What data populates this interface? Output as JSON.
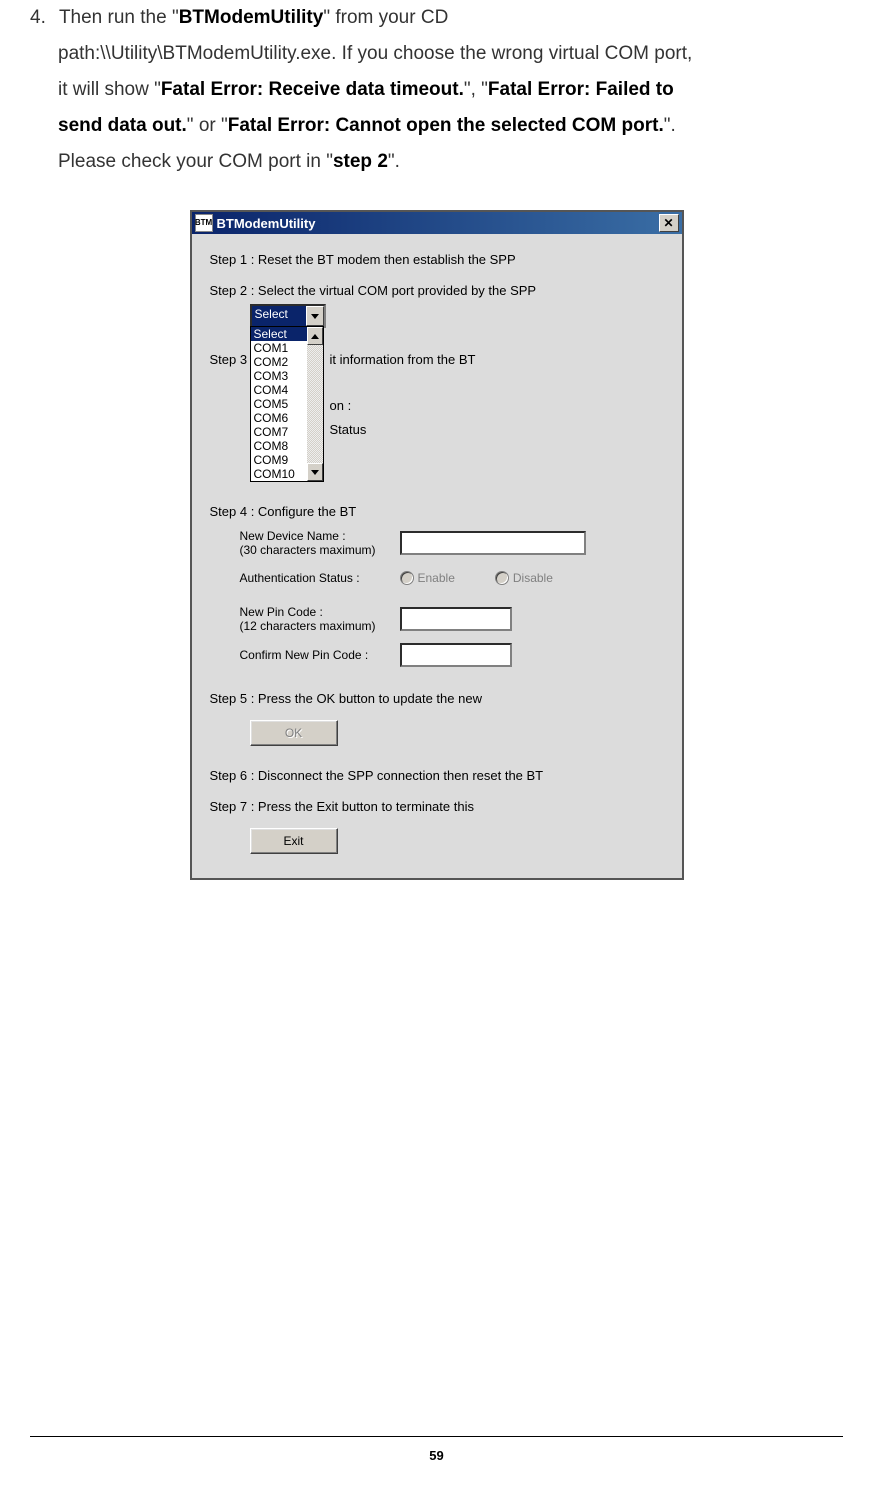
{
  "intro": {
    "number": "4.",
    "part1_pre": "Then run the \"",
    "part1_bold": "BTModemUtility",
    "part1_post": "\" from your CD",
    "line2_pre": "path:\\\\Utility\\BTModemUtility.exe. If you choose the wrong virtual COM port,",
    "line3_pre": "it will show \"",
    "err1": "Fatal Error: Receive data timeout.",
    "line3_mid": "\", \"",
    "err2": "Fatal Error: Failed to",
    "line4_err2b": "send data out.",
    "line4_mid": "\" or \"",
    "err3": "Fatal Error: Cannot open the selected COM port.",
    "line4_post": "\".",
    "line5_pre": "Please check your COM port in \"",
    "step2": "step 2",
    "line5_post": "\"."
  },
  "dialog": {
    "icon_text": "BTM",
    "title": "BTModemUtility",
    "close_glyph": "✕",
    "step1": "Step 1 : Reset the BT modem then establish the SPP",
    "step2": "Step 2 : Select the virtual COM port provided by the SPP",
    "combo_selected": "Select",
    "dropdown": [
      "Select",
      "COM1",
      "COM2",
      "COM3",
      "COM4",
      "COM5",
      "COM6",
      "COM7",
      "COM8",
      "COM9",
      "COM10"
    ],
    "step3_label": "Step 3 :",
    "step3_right_a": "it information from the BT",
    "step3_right_b": "on :",
    "step3_right_c": "Status",
    "step4": "Step 4 : Configure the BT",
    "new_device_name": "New Device Name :",
    "new_device_hint": "(30 characters maximum)",
    "auth_status": "Authentication Status :",
    "enable": "Enable",
    "disable": "Disable",
    "new_pin": "New Pin Code :",
    "new_pin_hint": "(12 characters maximum)",
    "confirm_pin": "Confirm New Pin Code :",
    "step5": "Step 5 : Press the OK button to update the new",
    "ok_btn": "OK",
    "step6": "Step 6 : Disconnect the SPP connection then reset the BT",
    "step7": "Step 7 : Press the Exit button to terminate this",
    "exit_btn": "Exit"
  },
  "page_number": "59"
}
